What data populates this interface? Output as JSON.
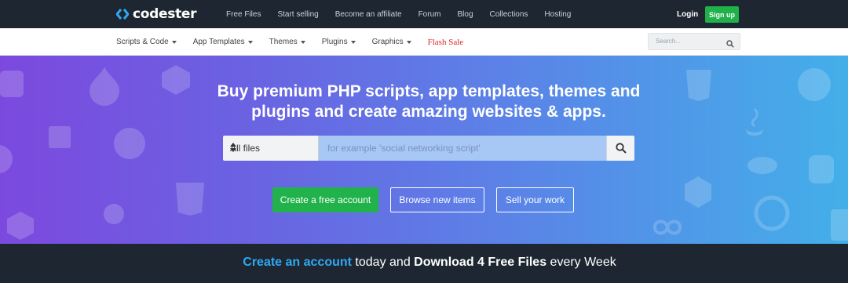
{
  "header": {
    "logo_text": "codester",
    "nav": [
      "Free Files",
      "Start selling",
      "Become an affiliate",
      "Forum",
      "Blog",
      "Collections",
      "Hosting"
    ],
    "login_label": "Login",
    "signup_label": "Sign up"
  },
  "subnav": {
    "items": [
      "Scripts & Code",
      "App Templates",
      "Themes",
      "Plugins",
      "Graphics"
    ],
    "flash_sale": "Flash Sale",
    "search_placeholder": "Search..."
  },
  "hero": {
    "title_parts": [
      "Buy premium ",
      "PHP scripts",
      ", ",
      "app templates",
      ", ",
      "themes",
      " and",
      "plugins",
      " and create amazing websites & apps."
    ],
    "select_value": "All files",
    "search_placeholder": "for example 'social networking script'",
    "create_account_label": "Create a free account",
    "browse_label": "Browse new items",
    "sell_label": "Sell your work"
  },
  "banner": {
    "link_text": "Create an account",
    "mid_text": " today and ",
    "bold_text": "Download 4 Free Files",
    "end_text": " every Week"
  },
  "colors": {
    "topbar": "#1e2731",
    "accent_green": "#22b24c",
    "flash_red": "#e0242a",
    "banner_link": "#2fa9f4"
  }
}
